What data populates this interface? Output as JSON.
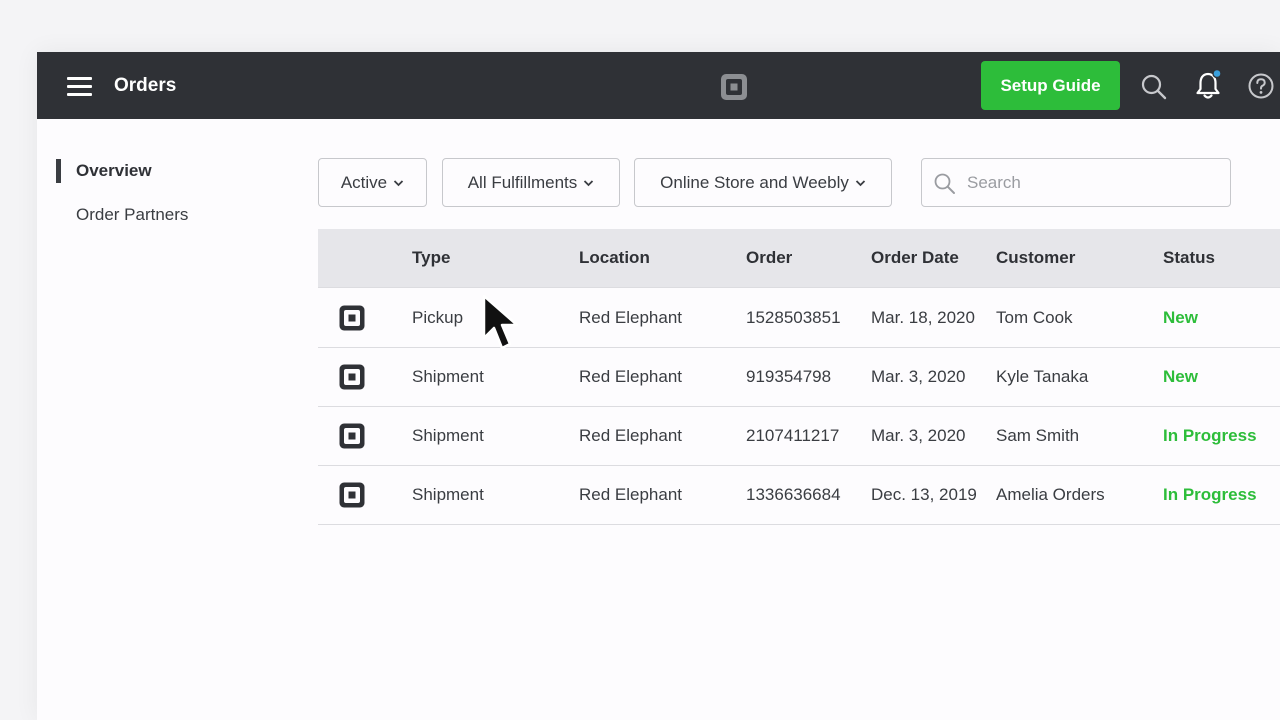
{
  "header": {
    "title": "Orders",
    "setup_label": "Setup Guide",
    "icons": [
      "menu-icon",
      "square-logo-icon",
      "search-icon",
      "bell-icon",
      "help-icon"
    ],
    "notification_dot_color": "#3a9fdc"
  },
  "sidebar": {
    "items": [
      {
        "label": "Overview",
        "active": true
      },
      {
        "label": "Order Partners",
        "active": false
      }
    ]
  },
  "filters": {
    "status": "Active",
    "fulfillment": "All Fulfillments",
    "channel": "Online Store and Weebly"
  },
  "search": {
    "placeholder": "Search",
    "value": ""
  },
  "table": {
    "columns": [
      "Type",
      "Location",
      "Order",
      "Order Date",
      "Customer",
      "Status"
    ],
    "rows": [
      {
        "type": "Pickup",
        "location": "Red Elephant",
        "order": "1528503851",
        "date": "Mar. 18, 2020",
        "customer": "Tom Cook",
        "status": "New"
      },
      {
        "type": "Shipment",
        "location": "Red Elephant",
        "order": "919354798",
        "date": "Mar. 3, 2020",
        "customer": "Kyle Tanaka",
        "status": "New"
      },
      {
        "type": "Shipment",
        "location": "Red Elephant",
        "order": "2107411217",
        "date": "Mar. 3, 2020",
        "customer": "Sam Smith",
        "status": "In Progress"
      },
      {
        "type": "Shipment",
        "location": "Red Elephant",
        "order": "1336636684",
        "date": "Dec. 13, 2019",
        "customer": "Amelia Orders",
        "status": "In Progress"
      }
    ]
  },
  "colors": {
    "topbar": "#2f3136",
    "accent_green": "#2dbd3a",
    "header_row": "#e6e6ea"
  }
}
